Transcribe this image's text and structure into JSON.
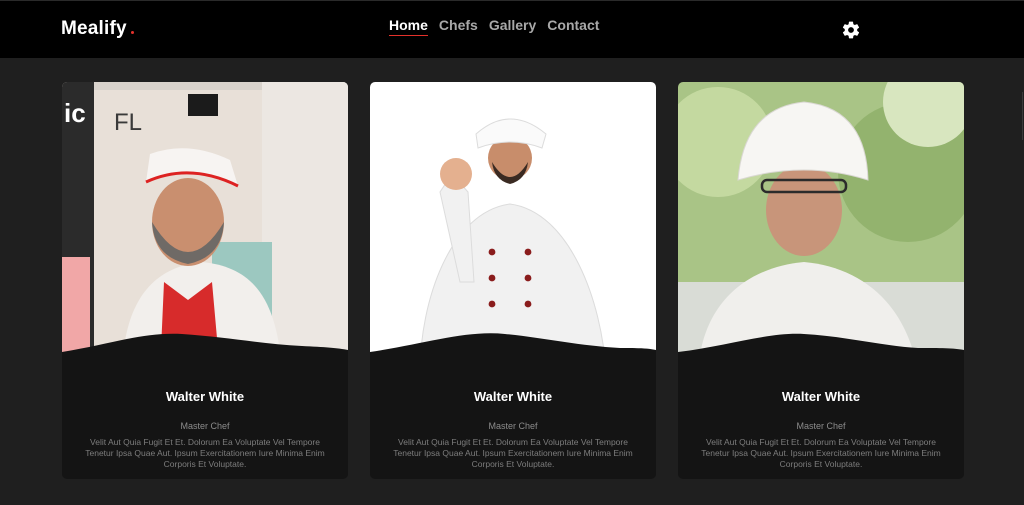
{
  "header": {
    "brand": "Mealify",
    "nav": [
      {
        "label": "Home",
        "active": true
      },
      {
        "label": "Chefs",
        "active": false
      },
      {
        "label": "Gallery",
        "active": false
      },
      {
        "label": "Contact",
        "active": false
      }
    ],
    "settings_icon": "gear-icon",
    "accent_color": "#e4312b"
  },
  "chefs": [
    {
      "name": "Walter White",
      "role": "Master Chef",
      "description": "Velit Aut Quia Fugit Et Et. Dolorum Ea Voluptate Vel Tempore Tenetur Ipsa Quae Aut. Ipsum Exercitationem Iure Minima Enim Corporis Et Voluptate."
    },
    {
      "name": "Walter White",
      "role": "Master Chef",
      "description": "Velit Aut Quia Fugit Et Et. Dolorum Ea Voluptate Vel Tempore Tenetur Ipsa Quae Aut. Ipsum Exercitationem Iure Minima Enim Corporis Et Voluptate."
    },
    {
      "name": "Walter White",
      "role": "Master Chef",
      "description": "Velit Aut Quia Fugit Et Et. Dolorum Ea Voluptate Vel Tempore Tenetur Ipsa Quae Aut. Ipsum Exercitationem Iure Minima Enim Corporis Et Voluptate."
    }
  ]
}
